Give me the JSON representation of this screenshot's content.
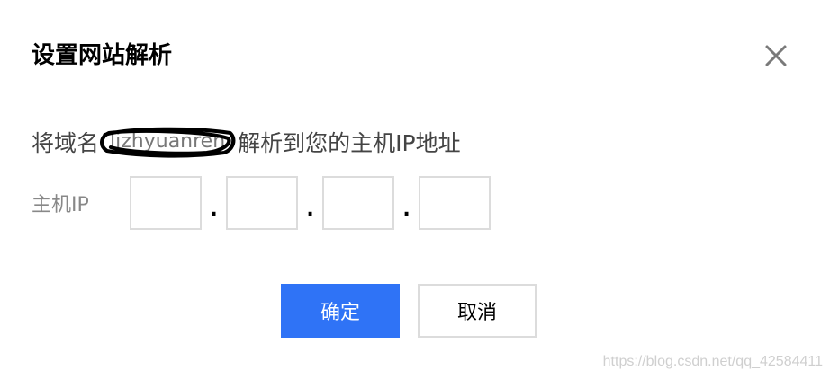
{
  "dialog": {
    "title": "设置网站解析",
    "close_icon": "close-icon",
    "description": {
      "prefix": "将域名",
      "domain": "lizhyuanren",
      "suffix": "解析到您的主机IP地址"
    },
    "ip": {
      "label": "主机IP",
      "separator": ".",
      "octets": [
        "",
        "",
        "",
        ""
      ]
    },
    "buttons": {
      "confirm": "确定",
      "cancel": "取消"
    },
    "colors": {
      "primary": "#2f73f6",
      "border": "#dcdcdc"
    }
  },
  "watermark": "https://blog.csdn.net/qq_42584411"
}
